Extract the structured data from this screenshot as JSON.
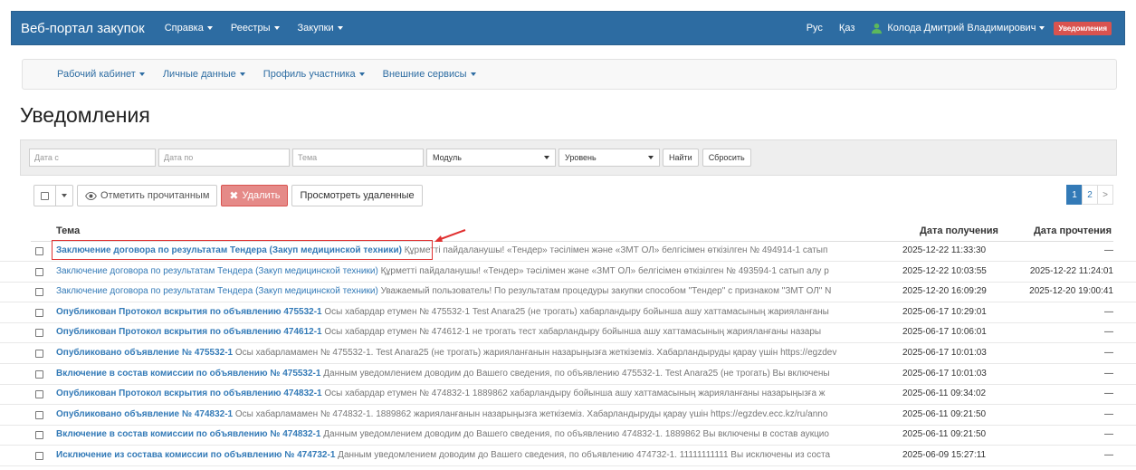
{
  "header": {
    "brand": "Веб-портал закупок",
    "nav": [
      "Справка",
      "Реестры",
      "Закупки"
    ],
    "lang_ru": "Рус",
    "lang_kz": "Қаз",
    "user": "Колода Дмитрий Владимирович",
    "notifications_badge": "Уведомления"
  },
  "subnav": [
    "Рабочий кабинет",
    "Личные данные",
    "Профиль участника",
    "Внешние сервисы"
  ],
  "page_title": "Уведомления",
  "filter": {
    "date_from": "Дата с",
    "date_to": "Дата по",
    "topic": "Тема",
    "module": "Модуль",
    "level": "Уровень",
    "find": "Найти",
    "reset": "Сбросить"
  },
  "toolbar": {
    "mark_read": "Отметить прочитанным",
    "delete": "Удалить",
    "view_deleted": "Просмотреть удаленные"
  },
  "pagination": {
    "pages": [
      "1",
      "2"
    ],
    "next": ">"
  },
  "table": {
    "col_subject": "Тема",
    "col_received": "Дата получения",
    "col_read": "Дата прочтения",
    "rows": [
      {
        "title": "Заключение договора по результатам Тендера (Закуп медицинской техники)",
        "preview": "Құрметті пайдаланушы! «Тендер» тәсілімен және «ЗМТ ОЛ» белгісімен өткізілген № 494914-1 сатып",
        "received": "2025-12-22 11:33:30",
        "read": "—",
        "bold": true
      },
      {
        "title": "Заключение договора по результатам Тендера (Закуп медицинской техники)",
        "preview": "Құрметті пайдаланушы! «Тендер» тәсілімен және «ЗМТ ОЛ» белгісімен өткізілген № 493594-1 сатып алу р",
        "received": "2025-12-22 10:03:55",
        "read": "2025-12-22 11:24:01",
        "bold": false
      },
      {
        "title": "Заключение договора по результатам Тендера (Закуп медицинской техники)",
        "preview": "Уважаемый пользователь! По результатам процедуры закупки способом \"Тендер\" с признаком \"ЗМТ ОЛ\" N",
        "received": "2025-12-20 16:09:29",
        "read": "2025-12-20 19:00:41",
        "bold": false
      },
      {
        "title": "Опубликован Протокол вскрытия по объявлению 475532-1",
        "preview": "Осы хабардар етумен № 475532-1 Test Anara25 (не трогать) хабарландыру бойынша ашу хаттамасының жарияланғаны",
        "received": "2025-06-17 10:29:01",
        "read": "—",
        "bold": true
      },
      {
        "title": "Опубликован Протокол вскрытия по объявлению 474612-1",
        "preview": "Осы хабардар етумен № 474612-1 не трогать тест хабарландыру бойынша ашу хаттамасының жарияланғаны назары",
        "received": "2025-06-17 10:06:01",
        "read": "—",
        "bold": true
      },
      {
        "title": "Опубликовано объявление № 475532-1",
        "preview": "Осы хабарламамен № 475532-1. Test Anara25 (не трогать) жарияланғанын назарыңызға жеткіземіз. Хабарландыруды қарау үшін https://egzdev",
        "received": "2025-06-17 10:01:03",
        "read": "—",
        "bold": true
      },
      {
        "title": "Включение в состав комиссии по объявлению № 475532-1",
        "preview": "Данным уведомлением доводим до Вашего сведения, по объявлению 475532-1. Test Anara25 (не трогать) Вы включены",
        "received": "2025-06-17 10:01:03",
        "read": "—",
        "bold": true
      },
      {
        "title": "Опубликован Протокол вскрытия по объявлению 474832-1",
        "preview": "Осы хабардар етумен № 474832-1 1889862 хабарландыру бойынша ашу хаттамасының жарияланғаны назарыңызға ж",
        "received": "2025-06-11 09:34:02",
        "read": "—",
        "bold": true
      },
      {
        "title": "Опубликовано объявление № 474832-1",
        "preview": "Осы хабарламамен № 474832-1. 1889862 жарияланғанын назарыңызға жеткіземіз. Хабарландыруды қарау үшін https://egzdev.ecc.kz/ru/anno",
        "received": "2025-06-11 09:21:50",
        "read": "—",
        "bold": true
      },
      {
        "title": "Включение в состав комиссии по объявлению № 474832-1",
        "preview": "Данным уведомлением доводим до Вашего сведения, по объявлению 474832-1. 1889862 Вы включены в состав аукцио",
        "received": "2025-06-11 09:21:50",
        "read": "—",
        "bold": true
      },
      {
        "title": "Исключение из состава комиссии по объявлению № 474732-1",
        "preview": "Данным уведомлением доводим до Вашего сведения, по объявлению 474732-1. 11111111111 Вы исключены из соста",
        "received": "2025-06-09 15:27:11",
        "read": "—",
        "bold": true
      }
    ]
  },
  "colors": {
    "navbar": "#2d6ca2",
    "link": "#337ab7",
    "danger": "#d9534f",
    "highlight": "#e03030"
  }
}
